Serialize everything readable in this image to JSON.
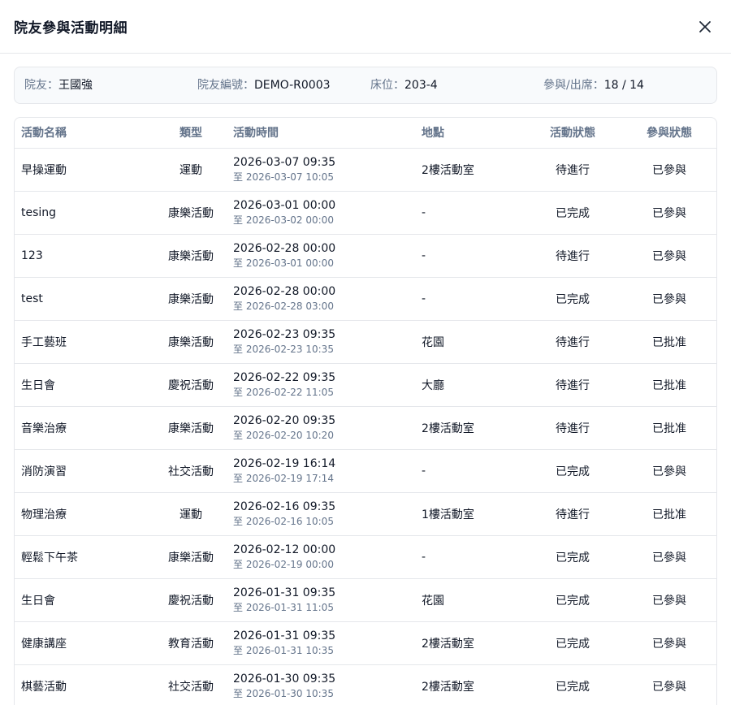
{
  "modal": {
    "title": "院友參與活動明細"
  },
  "resident": {
    "name_label": "院友：",
    "name": "王國強",
    "id_label": "院友編號：",
    "id": "DEMO-R0003",
    "bed_label": "床位：",
    "bed": "203-4",
    "attend_label": "參與/出席：",
    "attend": "18 / 14"
  },
  "table": {
    "headers": [
      "活動名稱",
      "類型",
      "活動時間",
      "地點",
      "活動狀態",
      "參與狀態"
    ],
    "rows": [
      {
        "name": "早操運動",
        "type": "運動",
        "start": "2026-03-07 09:35",
        "end": "至 2026-03-07 10:05",
        "location": "2樓活動室",
        "status": "待進行",
        "participation": "已參與"
      },
      {
        "name": "tesing",
        "type": "康樂活動",
        "start": "2026-03-01 00:00",
        "end": "至 2026-03-02 00:00",
        "location": "-",
        "status": "已完成",
        "participation": "已參與"
      },
      {
        "name": "123",
        "type": "康樂活動",
        "start": "2026-02-28 00:00",
        "end": "至 2026-03-01 00:00",
        "location": "-",
        "status": "待進行",
        "participation": "已參與"
      },
      {
        "name": "test",
        "type": "康樂活動",
        "start": "2026-02-28 00:00",
        "end": "至 2026-02-28 03:00",
        "location": "-",
        "status": "已完成",
        "participation": "已參與"
      },
      {
        "name": "手工藝班",
        "type": "康樂活動",
        "start": "2026-02-23 09:35",
        "end": "至 2026-02-23 10:35",
        "location": "花園",
        "status": "待進行",
        "participation": "已批准"
      },
      {
        "name": "生日會",
        "type": "慶祝活動",
        "start": "2026-02-22 09:35",
        "end": "至 2026-02-22 11:05",
        "location": "大廳",
        "status": "待進行",
        "participation": "已批准"
      },
      {
        "name": "音樂治療",
        "type": "康樂活動",
        "start": "2026-02-20 09:35",
        "end": "至 2026-02-20 10:20",
        "location": "2樓活動室",
        "status": "待進行",
        "participation": "已批准"
      },
      {
        "name": "消防演習",
        "type": "社交活動",
        "start": "2026-02-19 16:14",
        "end": "至 2026-02-19 17:14",
        "location": "-",
        "status": "已完成",
        "participation": "已參與"
      },
      {
        "name": "物理治療",
        "type": "運動",
        "start": "2026-02-16 09:35",
        "end": "至 2026-02-16 10:05",
        "location": "1樓活動室",
        "status": "待進行",
        "participation": "已批准"
      },
      {
        "name": "輕鬆下午茶",
        "type": "康樂活動",
        "start": "2026-02-12 00:00",
        "end": "至 2026-02-19 00:00",
        "location": "-",
        "status": "已完成",
        "participation": "已參與"
      },
      {
        "name": "生日會",
        "type": "慶祝活動",
        "start": "2026-01-31 09:35",
        "end": "至 2026-01-31 11:05",
        "location": "花園",
        "status": "已完成",
        "participation": "已參與"
      },
      {
        "name": "健康講座",
        "type": "教育活動",
        "start": "2026-01-31 09:35",
        "end": "至 2026-01-31 10:35",
        "location": "2樓活動室",
        "status": "已完成",
        "participation": "已參與"
      },
      {
        "name": "棋藝活動",
        "type": "社交活動",
        "start": "2026-01-30 09:35",
        "end": "至 2026-01-30 10:35",
        "location": "2樓活動室",
        "status": "已完成",
        "participation": "已參與"
      }
    ]
  },
  "icons": {
    "close": "close-icon"
  }
}
